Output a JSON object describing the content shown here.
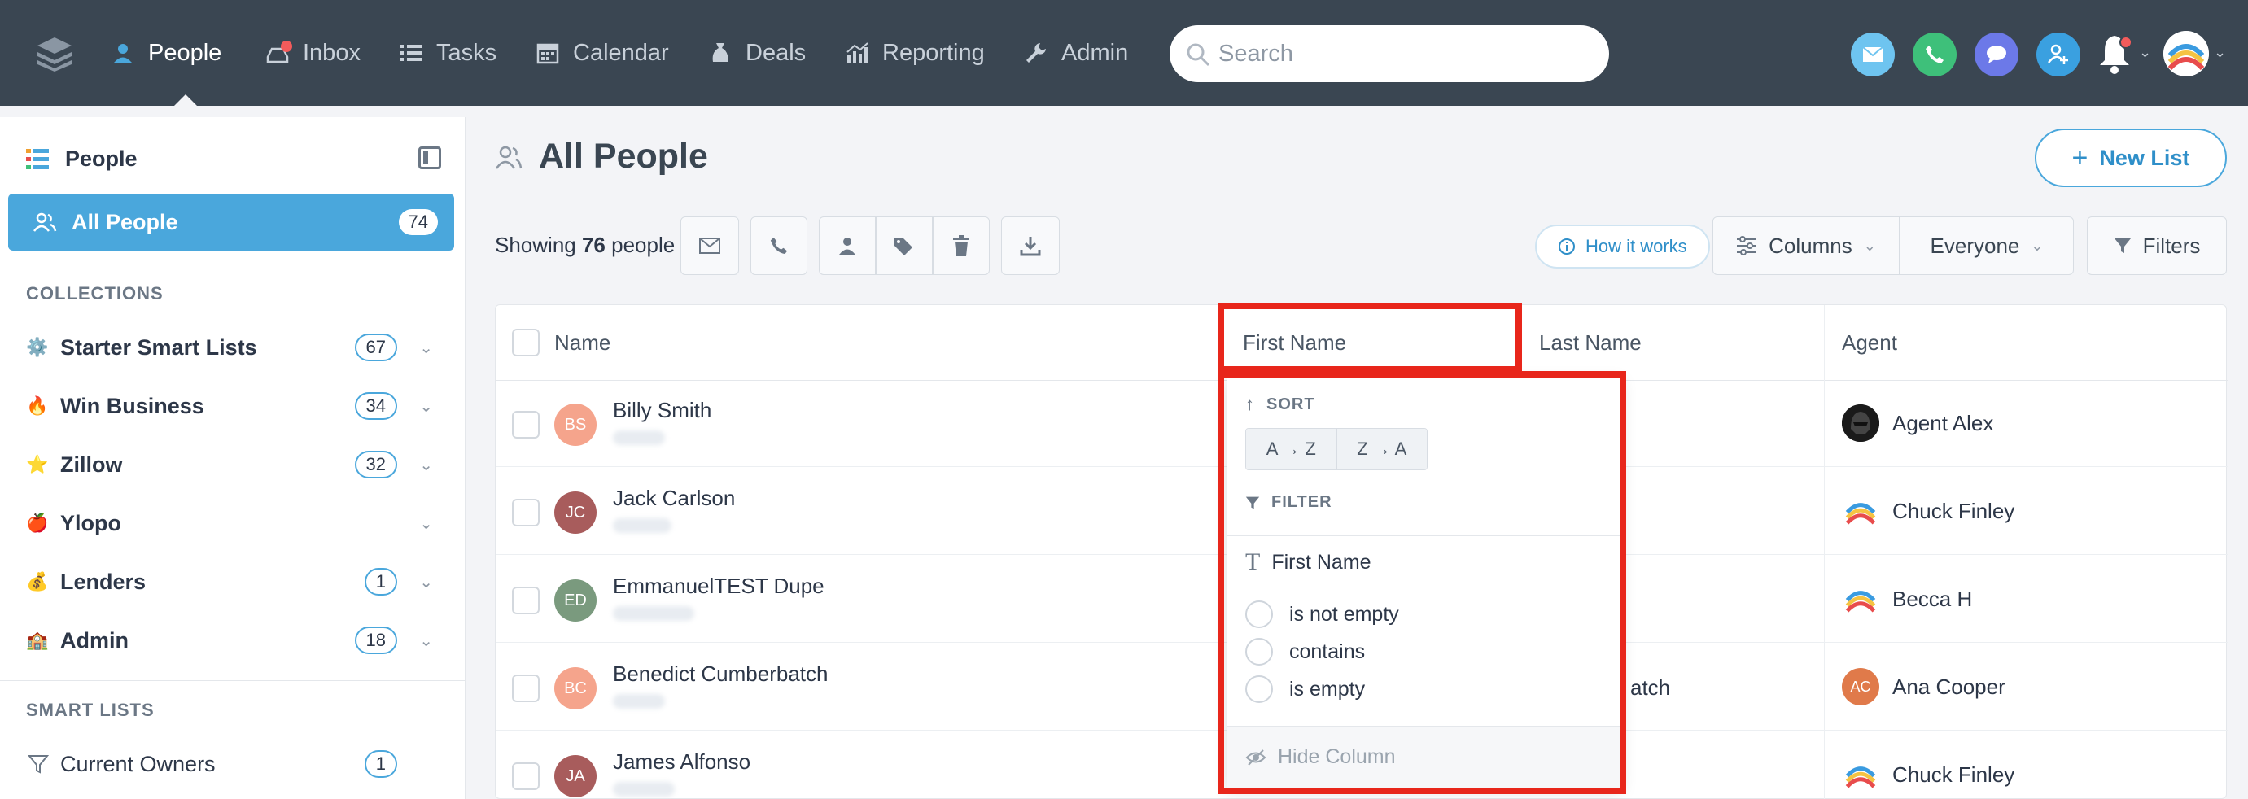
{
  "nav": {
    "items": [
      {
        "label": "People",
        "icon": "person-pin-icon",
        "active": true
      },
      {
        "label": "Inbox",
        "icon": "inbox-icon"
      },
      {
        "label": "Tasks",
        "icon": "tasks-list-icon"
      },
      {
        "label": "Calendar",
        "icon": "calendar-icon"
      },
      {
        "label": "Deals",
        "icon": "money-bag-icon"
      },
      {
        "label": "Reporting",
        "icon": "chart-icon"
      },
      {
        "label": "Admin",
        "icon": "wrench-icon"
      }
    ],
    "search_placeholder": "Search",
    "accent_color": "#4aa7dc"
  },
  "sidebar": {
    "title": "People",
    "active_item": {
      "label": "All People",
      "count": "74"
    },
    "collections_heading": "COLLECTIONS",
    "collections": [
      {
        "emoji": "⚙️",
        "label": "Starter Smart Lists",
        "count": "67"
      },
      {
        "emoji": "🔥",
        "label": "Win Business",
        "count": "34"
      },
      {
        "emoji": "⭐",
        "label": "Zillow",
        "count": "32"
      },
      {
        "emoji": "🍎",
        "label": "Ylopo",
        "count": ""
      },
      {
        "emoji": "💰",
        "label": "Lenders",
        "count": "1"
      },
      {
        "emoji": "🏫",
        "label": "Admin",
        "count": "18"
      }
    ],
    "smart_lists_heading": "SMART LISTS",
    "smart_lists": [
      {
        "label": "Current Owners",
        "count": "1"
      }
    ]
  },
  "main": {
    "title": "All People",
    "new_list_label": "New List",
    "showing_prefix": "Showing",
    "showing_count": "76",
    "showing_suffix": "people",
    "how_it_works": "How it works",
    "columns_label": "Columns",
    "everyone_label": "Everyone",
    "filters_label": "Filters"
  },
  "table": {
    "headers": {
      "name": "Name",
      "first_name": "First Name",
      "last_name": "Last Name",
      "agent": "Agent"
    },
    "rows": [
      {
        "initials": "BS",
        "avatar_color": "#f5a48c",
        "name": "Billy Smith",
        "last_partial": "",
        "agent": "Agent Alex",
        "agent_avatar": "vader"
      },
      {
        "initials": "JC",
        "avatar_color": "#a85c5c",
        "name": "Jack Carlson",
        "last_partial": "",
        "agent": "Chuck Finley",
        "agent_avatar": "rainbow"
      },
      {
        "initials": "ED",
        "avatar_color": "#7a9a7e",
        "name": "EmmanuelTEST Dupe",
        "last_partial": "",
        "agent": "Becca H",
        "agent_avatar": "rainbow"
      },
      {
        "initials": "BC",
        "avatar_color": "#f5a48c",
        "name": "Benedict Cumberbatch",
        "last_partial": "atch",
        "agent": "Ana Cooper",
        "agent_avatar": "initials",
        "agent_initials": "AC",
        "agent_color": "#e07a4a"
      },
      {
        "initials": "JA",
        "avatar_color": "#a85c5c",
        "name": "James Alfonso",
        "last_partial": "",
        "agent": "Chuck Finley",
        "agent_avatar": "rainbow"
      }
    ]
  },
  "popup": {
    "sort_heading": "SORT",
    "sort_asc": "A → Z",
    "sort_desc": "Z → A",
    "filter_heading": "FILTER",
    "field_label": "First Name",
    "options": [
      "is not empty",
      "contains",
      "is empty"
    ],
    "hide_column": "Hide Column"
  }
}
